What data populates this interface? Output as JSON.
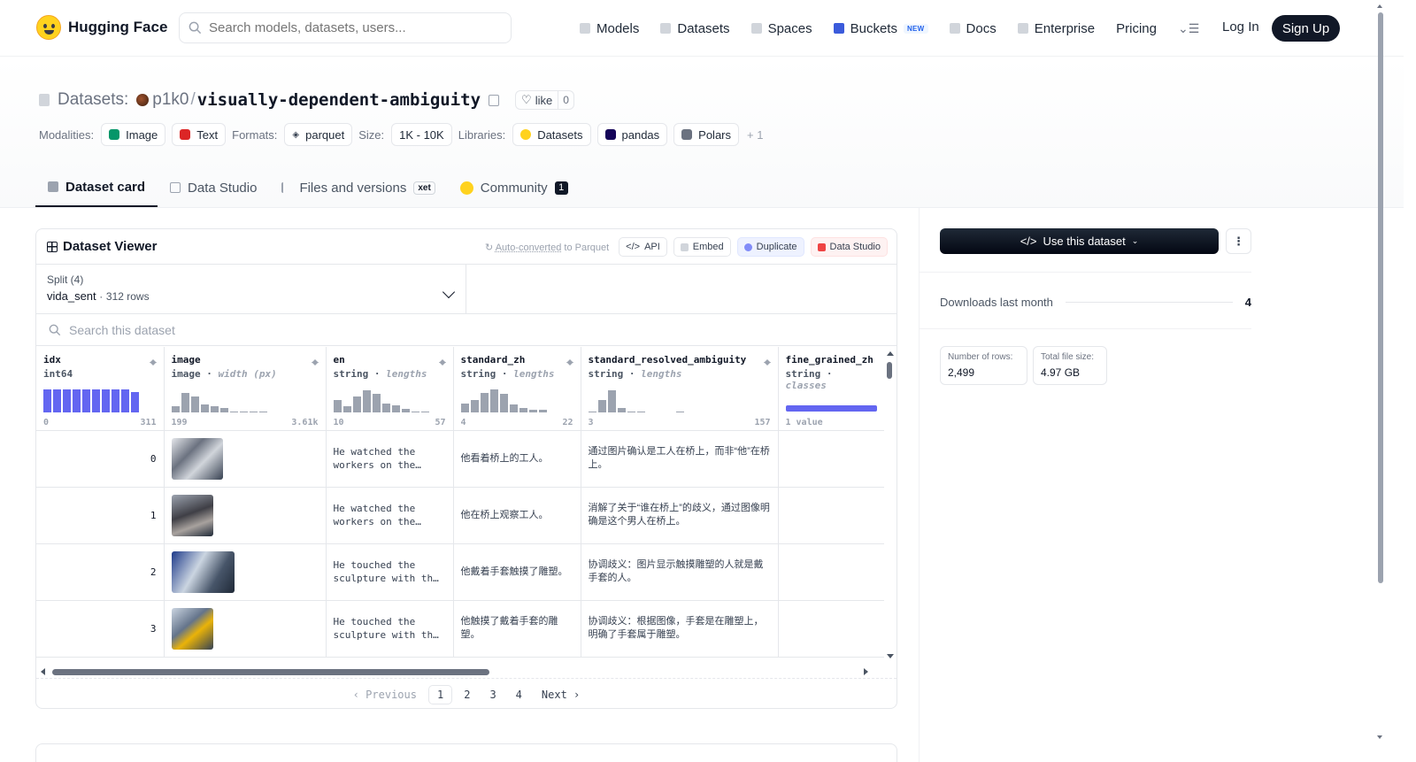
{
  "nav": {
    "brand": "Hugging Face",
    "search_placeholder": "Search models, datasets, users...",
    "items": [
      {
        "label": "Models",
        "icon": "cube-icon"
      },
      {
        "label": "Datasets",
        "icon": "database-icon"
      },
      {
        "label": "Spaces",
        "icon": "grid-icon"
      },
      {
        "label": "Buckets",
        "icon": "bucket-icon",
        "badge": "NEW"
      },
      {
        "label": "Docs",
        "icon": "book-icon"
      },
      {
        "label": "Enterprise",
        "icon": "enterprise-icon"
      },
      {
        "label": "Pricing"
      }
    ],
    "login": "Log In",
    "signup": "Sign Up"
  },
  "header": {
    "prefix": "Datasets:",
    "owner": "p1k0",
    "slash": "/",
    "name": "visually-dependent-ambiguity",
    "like_label": "like",
    "like_count": "0",
    "modalities_label": "Modalities:",
    "modalities": [
      {
        "label": "Image",
        "color": "#059669"
      },
      {
        "label": "Text",
        "color": "#dc2626"
      }
    ],
    "formats_label": "Formats:",
    "formats": [
      "parquet"
    ],
    "size_label": "Size:",
    "size": "1K - 10K",
    "libraries_label": "Libraries:",
    "libraries": [
      "Datasets",
      "pandas",
      "Polars"
    ],
    "more": "+ 1"
  },
  "tabs": [
    {
      "label": "Dataset card",
      "active": true
    },
    {
      "label": "Data Studio"
    },
    {
      "label": "Files and versions",
      "badge": "xet"
    },
    {
      "label": "Community",
      "count": "1"
    }
  ],
  "viewer": {
    "title": "Dataset Viewer",
    "autoconv_link": "Auto-converted",
    "autoconv_rest": " to Parquet",
    "actions": [
      "API",
      "Embed",
      "Duplicate",
      "Data Studio"
    ],
    "split_label": "Split (4)",
    "split_value": "vida_sent",
    "split_sep": "·",
    "split_rows": "312 rows",
    "search_placeholder": "Search this dataset",
    "columns": [
      {
        "name": "idx",
        "type": "int64",
        "hint": "",
        "min": "0",
        "max": "311",
        "hist": [
          1,
          1,
          1,
          1,
          1,
          1,
          1,
          1,
          1,
          0.9
        ],
        "indigo": true
      },
      {
        "name": "image",
        "type": "image",
        "hint": "width (px)",
        "min": "199",
        "max": "3.61k",
        "hist": [
          0.25,
          0.85,
          0.7,
          0.35,
          0.25,
          0.2,
          0.05,
          0.05,
          0.05,
          0.05
        ],
        "indigo": false
      },
      {
        "name": "en",
        "type": "string",
        "hint": "lengths",
        "min": "10",
        "max": "57",
        "hist": [
          0.55,
          0.25,
          0.7,
          0.95,
          0.8,
          0.4,
          0.3,
          0.15,
          0.05,
          0.05
        ],
        "indigo": false
      },
      {
        "name": "standard_zh",
        "type": "string",
        "hint": "lengths",
        "min": "4",
        "max": "22",
        "hist": [
          0.4,
          0.55,
          0.85,
          1.0,
          0.8,
          0.35,
          0.2,
          0.1,
          0.1
        ],
        "indigo": false
      },
      {
        "name": "standard_resolved_ambiguity",
        "type": "string",
        "hint": "lengths",
        "min": "3",
        "max": "157",
        "hist": [
          0.05,
          0.55,
          0.95,
          0.2,
          0.05,
          0.05,
          0,
          0,
          0,
          0.05
        ],
        "indigo": false
      },
      {
        "name": "fine_grained_zh",
        "type": "string",
        "hint": "classes",
        "min": "1 value",
        "max": "",
        "hist": [],
        "indigo": false
      }
    ],
    "rows": [
      {
        "idx": "0",
        "image": "photo-thumbnail",
        "en": "He watched the workers on the…",
        "standard_zh": "他看着桥上的工人。",
        "resolved": "通过图片确认是工人在桥上，而非“他”在桥上。",
        "fine": ""
      },
      {
        "idx": "1",
        "image": "photo-thumbnail",
        "en": "He watched the workers on the…",
        "standard_zh": "他在桥上观察工人。",
        "resolved": "消解了关于“谁在桥上”的歧义，通过图像明确是这个男人在桥上。",
        "fine": ""
      },
      {
        "idx": "2",
        "image": "photo-thumbnail",
        "en": "He touched the sculpture with th…",
        "standard_zh": "他戴着手套触摸了雕塑。",
        "resolved": "协调歧义：图片显示触摸雕塑的人就是戴手套的人。",
        "fine": ""
      },
      {
        "idx": "3",
        "image": "photo-thumbnail",
        "en": "He touched the sculpture with th…",
        "standard_zh": "他触摸了戴着手套的雕塑。",
        "resolved": "协调歧义：根据图像，手套是在雕塑上，明确了手套属于雕塑。",
        "fine": ""
      }
    ],
    "pager": {
      "prev": "‹ Previous",
      "pages": [
        "1",
        "2",
        "3",
        "4"
      ],
      "current": "1",
      "next": "Next ›"
    }
  },
  "sidebar": {
    "use_button": "Use this dataset",
    "downloads_label": "Downloads last month",
    "downloads_value": "4",
    "stats": [
      {
        "label": "Number of rows:",
        "value": "2,499"
      },
      {
        "label": "Total file size:",
        "value": "4.97 GB"
      }
    ]
  }
}
